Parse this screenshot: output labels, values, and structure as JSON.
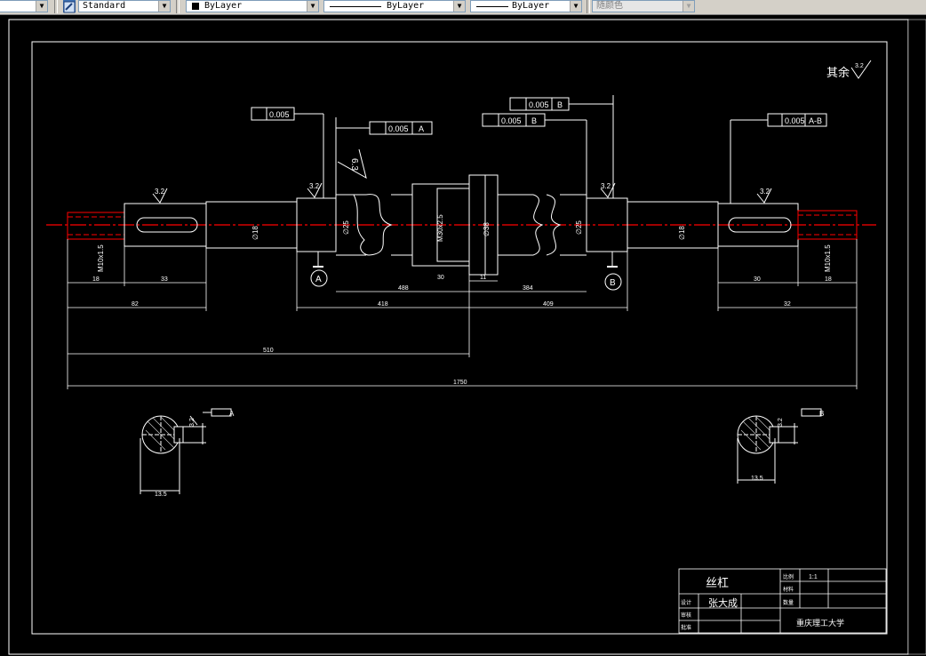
{
  "toolbar": {
    "text_style_value": "Standard",
    "layer_value": "ByLayer",
    "linetype_value": "ByLayer",
    "lineweight_value": "ByLayer",
    "plotstyle_value": "随颜色"
  },
  "drawing": {
    "surface_note": "其余",
    "surface_note_value": "3.2",
    "dimensions": {
      "d1": "18",
      "d2": "33",
      "d3": "82",
      "d4": "418",
      "d5": "488",
      "d6": "30",
      "d7": "11",
      "d8": "384",
      "d9": "409",
      "d10": "30",
      "d11": "32",
      "d12": "18",
      "d13": "510",
      "d14": "1750"
    },
    "diameter_labels": {
      "shaft_left": "∅18",
      "bearing_left": "∅25",
      "thread": "M30x2.5",
      "collar": "∅38",
      "bearing_right": "∅25",
      "shaft_right": "∅18",
      "end_left": "M10x1.5",
      "end_right": "M10x1.5"
    },
    "tolerances": {
      "runout_a": "0.005",
      "perp_a": "0.005",
      "perp_a_ref": "A",
      "perp_b1": "0.005",
      "perp_b1_ref": "B",
      "perp_b2": "0.005",
      "perp_b2_ref": "B",
      "runout_ab": "0.005",
      "runout_ab_ref": "A-B"
    },
    "roughness": {
      "r1": "6.3",
      "r2": "3.2",
      "r3": "3.2",
      "r4": "3.2",
      "r5": "3.2"
    },
    "datums": {
      "a": "A",
      "b": "B"
    },
    "sections": {
      "left_dim": "13.5",
      "right_dim": "13.5",
      "left_key": "3.2",
      "right_key": "3.2",
      "left_ref": "A",
      "right_ref": "B"
    },
    "title_block": {
      "part_name": "丝杠",
      "designer": "张大成",
      "school": "重庆理工大学",
      "label_design": "设计",
      "label_check": "审核",
      "label_approve": "批准",
      "label_scale": "比例",
      "label_material": "材料",
      "label_qty": "数量",
      "scale_value": "1:1"
    }
  },
  "colors": {
    "background": "#000000",
    "lines": "#ffffff",
    "centerline": "#ff0000",
    "toolbar": "#d4d0c8"
  }
}
